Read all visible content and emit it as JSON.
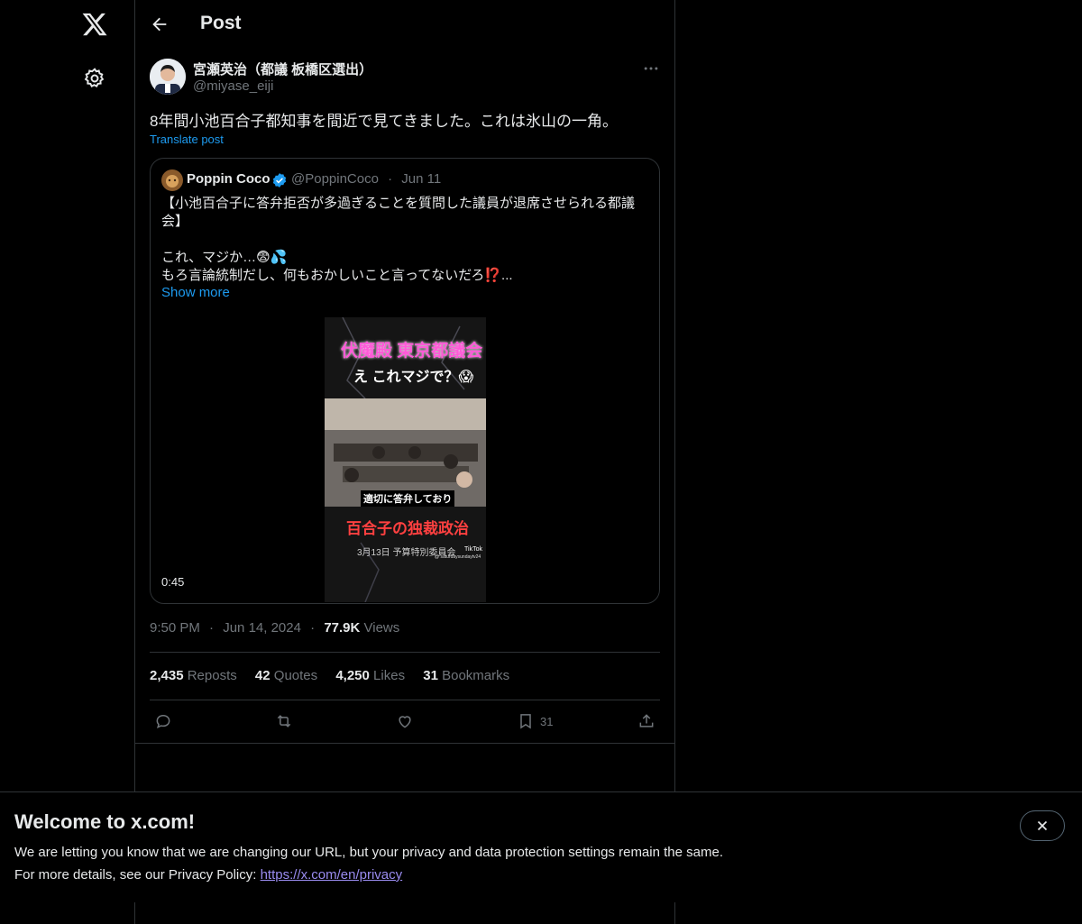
{
  "nav": {
    "logo_icon": "x-logo-icon",
    "settings_icon": "gear-icon"
  },
  "header": {
    "back_icon": "arrow-left-icon",
    "title": "Post"
  },
  "post": {
    "author_name": "宮瀬英治（都議 板橋区選出）",
    "author_handle": "@miyase_eiji",
    "more_icon": "more-horizontal-icon",
    "text": "8年間小池百合子都知事を間近で見てきました。これは氷山の一角。",
    "translate_label": "Translate post",
    "quote": {
      "name": "Poppin Coco",
      "verified_icon": "verified-badge-icon",
      "handle": "@PoppinCoco",
      "separator": "·",
      "date": "Jun 11",
      "line1": "【小池百合子に答弁拒否が多過ぎることを質問した議員が退席させられる都議会】",
      "line2": "これ、マジか…😨💦",
      "line3": "もろ言論統制だし、何もおかしいこと言ってないだろ⁉️...",
      "show_more": "Show more",
      "video": {
        "caption_top": "伏魔殿 東京都議会",
        "caption_sub": "え これマジで？😱",
        "caption_mid": "適切に答弁しており",
        "caption_bottom": "百合子の独裁政治",
        "caption_date": "3月13日 予算特別委員会",
        "watermark": "TikTok",
        "watermark_handle": "@ saturdaysundaytv24",
        "duration": "0:45"
      }
    },
    "time": "9:50 PM",
    "dot": "·",
    "date": "Jun 14, 2024",
    "views_count": "77.9K",
    "views_label": "Views",
    "stats": {
      "reposts_count": "2,435",
      "reposts_label": "Reposts",
      "quotes_count": "42",
      "quotes_label": "Quotes",
      "likes_count": "4,250",
      "likes_label": "Likes",
      "bookmarks_count": "31",
      "bookmarks_label": "Bookmarks"
    },
    "actions": {
      "reply_icon": "reply-icon",
      "repost_icon": "repost-icon",
      "like_icon": "heart-icon",
      "bookmark_icon": "bookmark-icon",
      "bookmark_count": "31",
      "share_icon": "share-icon"
    }
  },
  "banner": {
    "title": "Welcome to x.com!",
    "line1": "We are letting you know that we are changing our URL, but your privacy and data protection settings remain the same.",
    "line2_prefix": "For more details, see our Privacy Policy: ",
    "link": "https://x.com/en/privacy",
    "close_icon": "close-icon"
  },
  "colors": {
    "background": "#000000",
    "text": "#e7e9ea",
    "muted": "#71767b",
    "accent": "#1d9bf0",
    "border": "#2f3336"
  }
}
